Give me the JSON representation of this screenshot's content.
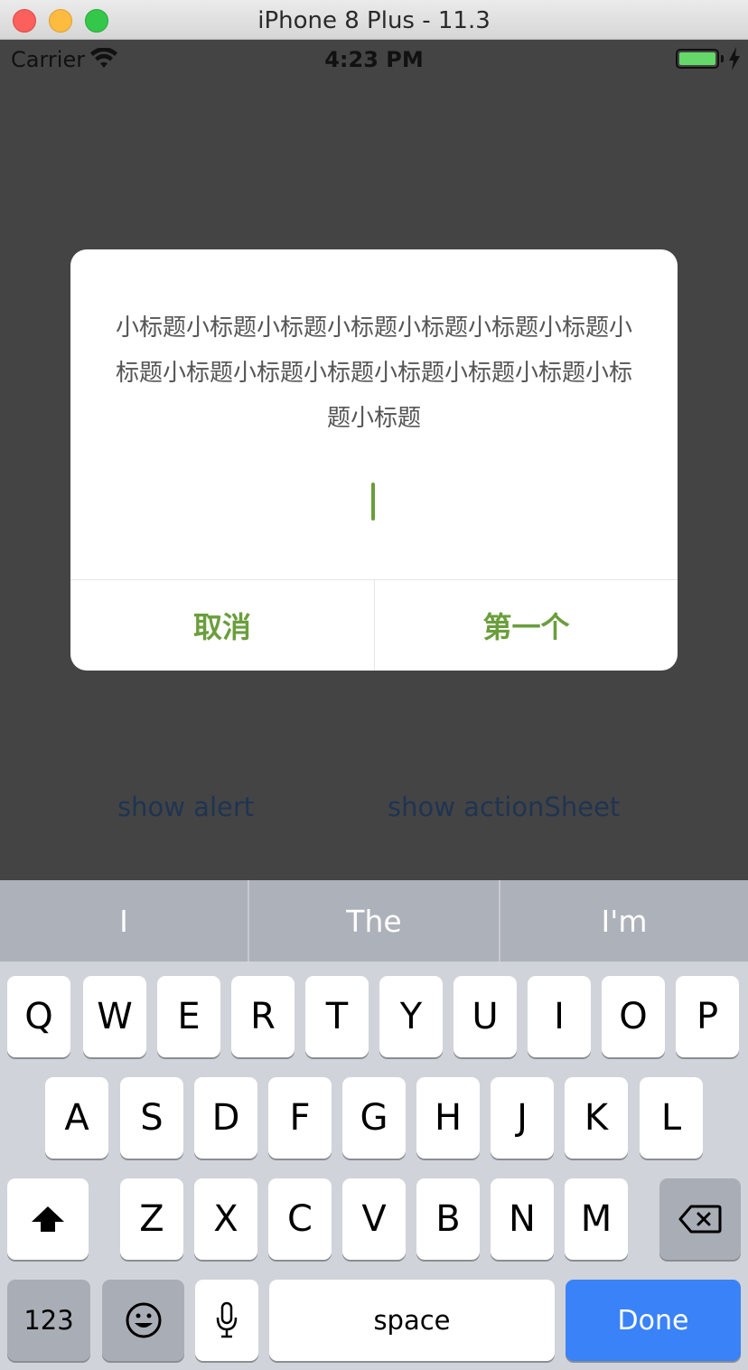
{
  "window": {
    "title": "iPhone 8 Plus - 11.3"
  },
  "status_bar": {
    "carrier": "Carrier",
    "time": "4:23 PM"
  },
  "background_links": {
    "show_alert": "show alert",
    "show_action_sheet": "show actionSheet"
  },
  "alert": {
    "message": "小标题小标题小标题小标题小标题小标题小标题小标题小标题小标题小标题小标题小标题小标题小标题小标题",
    "input_value": "",
    "cancel_label": "取消",
    "confirm_label": "第一个"
  },
  "colors": {
    "accent_green": "#6a9e3c",
    "done_blue": "#3a82f7",
    "overlay": "#444444"
  },
  "keyboard": {
    "suggestions": [
      "I",
      "The",
      "I'm"
    ],
    "row1": [
      "Q",
      "W",
      "E",
      "R",
      "T",
      "Y",
      "U",
      "I",
      "O",
      "P"
    ],
    "row2": [
      "A",
      "S",
      "D",
      "F",
      "G",
      "H",
      "J",
      "K",
      "L"
    ],
    "row3": [
      "Z",
      "X",
      "C",
      "V",
      "B",
      "N",
      "M"
    ],
    "numbers_label": "123",
    "space_label": "space",
    "done_label": "Done",
    "icons": {
      "shift": "shift-icon",
      "delete": "backspace-icon",
      "emoji": "emoji-icon",
      "mic": "microphone-icon"
    }
  }
}
